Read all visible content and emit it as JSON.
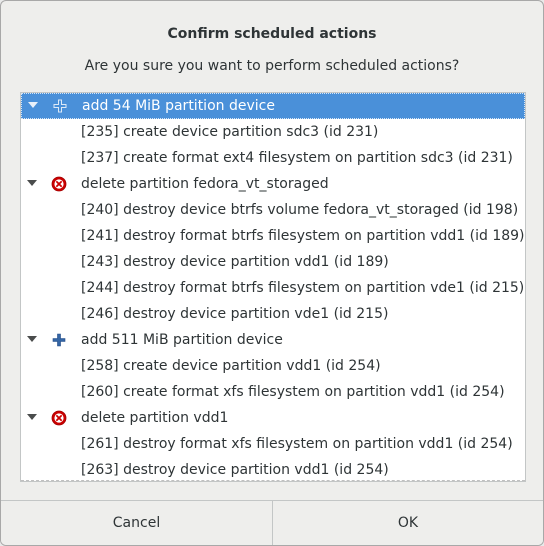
{
  "dialog": {
    "title": "Confirm scheduled actions",
    "question": "Are you sure you want to perform scheduled actions?"
  },
  "tree": {
    "rows": [
      {
        "kind": "group",
        "icon": "add",
        "label": "add 54 MiB partition device",
        "selected": true
      },
      {
        "kind": "child",
        "label": "[235] create device partition sdc3 (id 231)"
      },
      {
        "kind": "child",
        "label": "[237] create format ext4 filesystem on partition sdc3 (id 231)"
      },
      {
        "kind": "group",
        "icon": "delete",
        "label": "delete partition fedora_vt_storaged"
      },
      {
        "kind": "child",
        "label": "[240] destroy device btrfs volume fedora_vt_storaged (id 198)"
      },
      {
        "kind": "child",
        "label": "[241] destroy format btrfs filesystem on partition vdd1 (id 189)"
      },
      {
        "kind": "child",
        "label": "[243] destroy device partition vdd1 (id 189)"
      },
      {
        "kind": "child",
        "label": "[244] destroy format btrfs filesystem on partition vde1 (id 215)"
      },
      {
        "kind": "child",
        "label": "[246] destroy device partition vde1 (id 215)"
      },
      {
        "kind": "group",
        "icon": "add",
        "label": "add 511 MiB partition device"
      },
      {
        "kind": "child",
        "label": "[258] create device partition vdd1 (id 254)"
      },
      {
        "kind": "child",
        "label": "[260] create format xfs filesystem on partition vdd1 (id 254)"
      },
      {
        "kind": "group",
        "icon": "delete",
        "label": "delete partition vdd1"
      },
      {
        "kind": "child",
        "label": "[261] destroy format xfs filesystem on partition vdd1 (id 254)"
      },
      {
        "kind": "child",
        "label": "[263] destroy device partition vdd1 (id 254)"
      }
    ]
  },
  "buttons": {
    "cancel": "Cancel",
    "ok": "OK"
  },
  "colors": {
    "selection": "#4a90d9",
    "add_icon": "#3465a4",
    "delete_icon": "#cc0000"
  }
}
